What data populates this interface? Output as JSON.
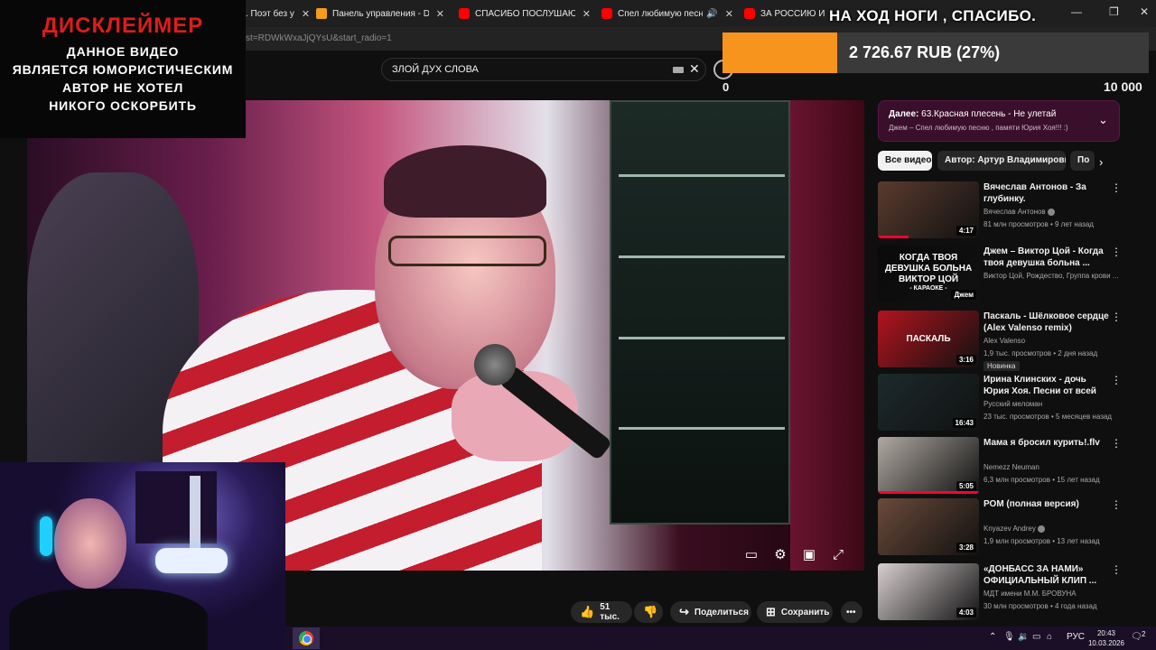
{
  "browser": {
    "tabs": [
      {
        "title": ". Поэт без у",
        "icon": "generic-tab-icon"
      },
      {
        "title": "Панель управления - Donation",
        "icon": "donationalerts-icon"
      },
      {
        "title": "СПАСИБО ПОСЛУШАЮ ТЕСТА",
        "icon": "youtube-icon"
      },
      {
        "title": "Спел любимую песню , па",
        "icon": "youtube-icon"
      },
      {
        "title": "ЗА РОССИЮ И СВОБОДУ",
        "icon": "youtube-icon"
      }
    ],
    "url_fragment": "st=RDWkWxaJjQYsU&start_radio=1"
  },
  "youtube": {
    "search_value": "ЗЛОЙ ДУХ СЛОВА",
    "header_count_left": "0",
    "header_count_right": "10 000"
  },
  "donation": {
    "title": "НА ХОД НОГИ , СПАСИБО.",
    "amount": "2 726.67 RUB (27%)",
    "progress_percent": 27,
    "bar_color": "#f7941d"
  },
  "disclaimer": {
    "title": "ДИСКЛЕЙМЕР",
    "lines": [
      "ДАННОЕ ВИДЕО",
      "ЯВЛЯЕТСЯ ЮМОРИСТИЧЕСКИМ",
      "АВТОР НЕ ХОТЕЛ",
      "НИКОГО ОСКОРБИТЬ"
    ],
    "title_color": "#e01b1b"
  },
  "actions": {
    "likes": "51 тыс.",
    "share": "Поделиться",
    "save": "Сохранить"
  },
  "up_next": {
    "label": "Далее:",
    "title": "63.Красная плесень - Не улетай",
    "subtitle": "Джем – Спел любимую песню , памяти Юрия Хоя!!! :)"
  },
  "chips": [
    "Все видео",
    "Автор: Артур Владимирович",
    "По"
  ],
  "recommendations": [
    {
      "title": "Вячеслав Антонов - За глубинку.",
      "channel": "Вячеслав Антонов",
      "verified": true,
      "meta": "81 млн просмотров • 9 лет назад",
      "duration": "4:17",
      "badge": "",
      "watched": 0.3,
      "thumb": "#5a3b2e"
    },
    {
      "title": "Джем – Виктор Цой - Когда твоя девушка больна ...",
      "channel": "Виктор Цой, Рождество, Группа крови ...",
      "verified": false,
      "meta": "",
      "duration": "Джем",
      "badge": "",
      "watched": 0,
      "thumb": "#0a0a0a",
      "thumb_text": [
        "КОГДА ТВОЯ",
        "ДЕВУШКА БОЛЬНА",
        "ВИКТОР ЦОЙ",
        "- КАРАОКЕ -"
      ]
    },
    {
      "title": "Паскаль - Шёлковое сердце (Alex Valenso remix)",
      "channel": "Alex Valenso",
      "verified": false,
      "meta": "1,9 тыс. просмотров • 2 дня назад",
      "duration": "3:16",
      "badge": "Новинка",
      "watched": 0,
      "thumb": "#b3141f",
      "thumb_text": [
        "ПАСКАЛЬ"
      ]
    },
    {
      "title": "Ирина Клинских - дочь Юрия Хоя. Песни от всей души. ...",
      "channel": "Русский меломан",
      "verified": false,
      "meta": "23 тыс. просмотров • 5 месяцев назад",
      "duration": "16:43",
      "badge": "",
      "watched": 0,
      "thumb": "#1c2a2c"
    },
    {
      "title": "Мама я бросил курить!.flv",
      "channel": "Nemezz Neuman",
      "verified": false,
      "meta": "6,3 млн просмотров • 15 лет назад",
      "duration": "5:05",
      "badge": "",
      "watched": 1.0,
      "thumb": "#b0a9a2"
    },
    {
      "title": "РОМ (полная версия)",
      "channel": "Knyazev Andrey",
      "verified": true,
      "meta": "1,9 млн просмотров • 13 лет назад",
      "duration": "3:28",
      "badge": "",
      "watched": 0,
      "thumb": "#6a4a3a"
    },
    {
      "title": "«ДОНБАСС ЗА НАМИ» ОФИЦИАЛЬНЫЙ КЛИП ...",
      "channel": "МДТ имени М.М. БРОВУНА",
      "verified": false,
      "meta": "30 млн просмотров • 4 года назад",
      "duration": "4:03",
      "badge": "",
      "watched": 0,
      "thumb": "#d8cfd0"
    }
  ],
  "taskbar": {
    "language": "РУС",
    "time": "20:43",
    "date": "10.03.2026",
    "notifications": "2"
  }
}
